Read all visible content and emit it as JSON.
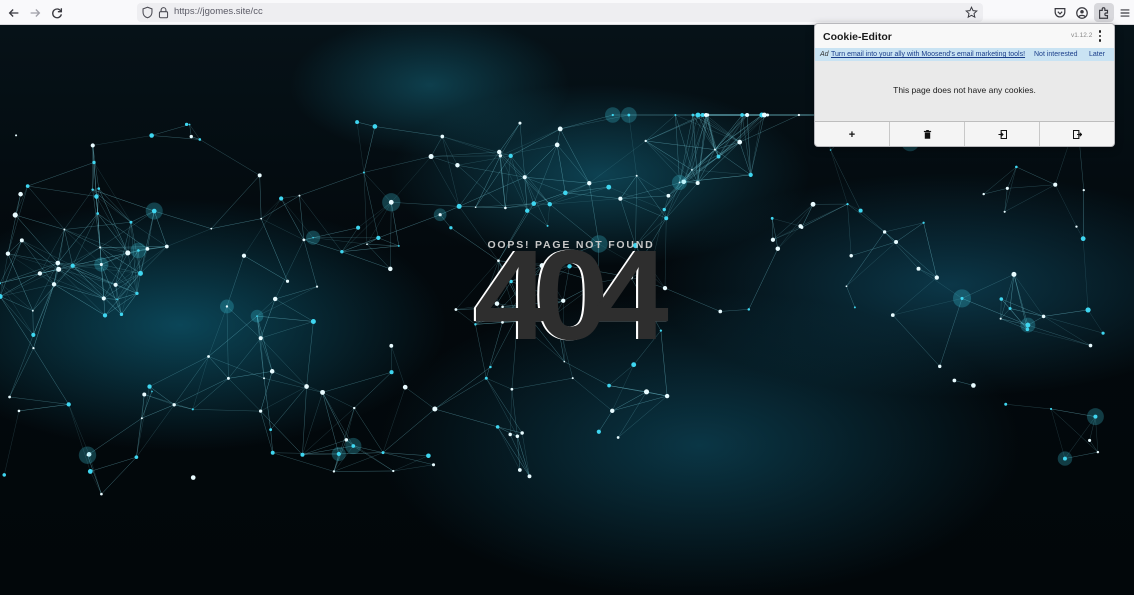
{
  "browser": {
    "url": "https://jgomes.site/cc",
    "icons": {
      "back": "arrow-left-icon",
      "forward": "arrow-right-icon",
      "reload": "reload-icon",
      "shield": "shield-icon",
      "lock": "lock-icon",
      "bookmark": "star-icon",
      "pocket": "pocket-icon",
      "account": "account-icon",
      "extensions": "puzzle-icon",
      "menu": "hamburger-menu-icon"
    }
  },
  "page": {
    "heading": "OOPS! PAGE NOT FOUND",
    "code": "404",
    "accent_color": "#3fd6f0"
  },
  "cookie_editor": {
    "title": "Cookie-Editor",
    "version": "v1.12.2",
    "ad": {
      "tag": "Ad",
      "link_text": "Turn email into your ally with Moosend's email marketing tools!",
      "dismiss": "Not interested",
      "later": "Later"
    },
    "message": "This page does not have any cookies.",
    "actions": [
      {
        "label": "+",
        "icon": "plus-icon"
      },
      {
        "label": "",
        "icon": "trash-icon"
      },
      {
        "label": "",
        "icon": "import-icon"
      },
      {
        "label": "",
        "icon": "export-icon"
      }
    ]
  }
}
